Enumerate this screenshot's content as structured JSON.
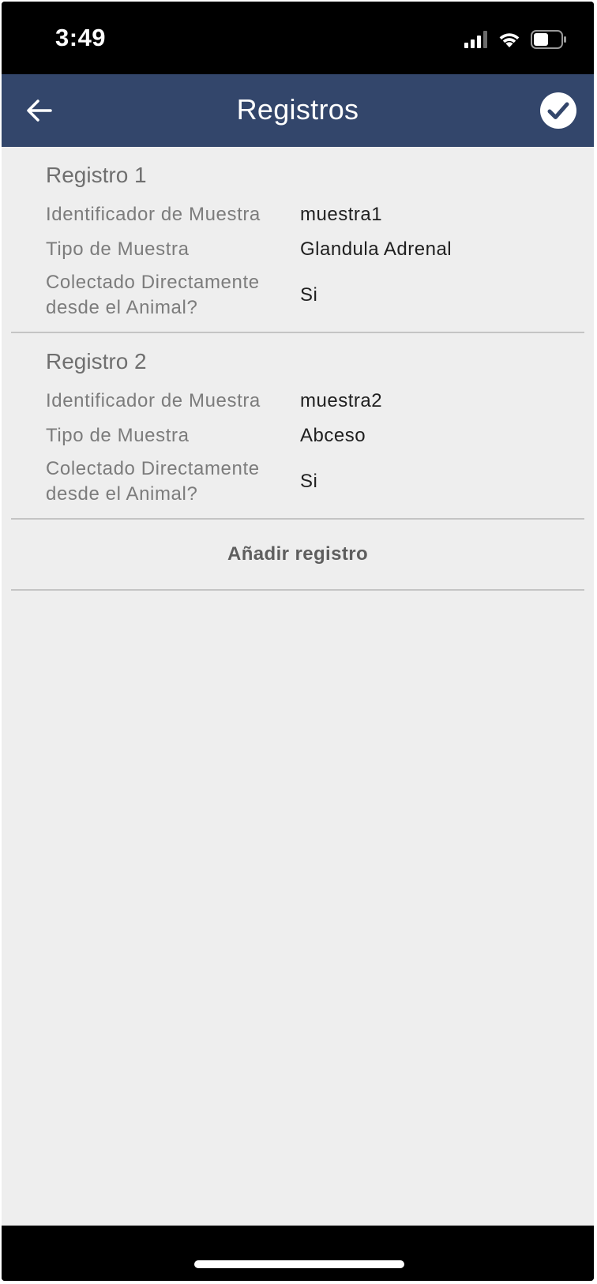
{
  "status_bar": {
    "time": "3:49",
    "icons": [
      "cellular-signal-icon",
      "wifi-icon",
      "battery-icon"
    ]
  },
  "header": {
    "title": "Registros",
    "back_icon": "arrow-left-icon",
    "confirm_icon": "check-circle-icon",
    "background_color": "#33466b"
  },
  "records": [
    {
      "title": "Registro 1",
      "fields": [
        {
          "label": "Identificador de Muestra",
          "value": "muestra1"
        },
        {
          "label": "Tipo de Muestra",
          "value": "Glandula Adrenal"
        },
        {
          "label": "Colectado Directamente desde el Animal?",
          "value": "Si"
        }
      ]
    },
    {
      "title": "Registro 2",
      "fields": [
        {
          "label": "Identificador de Muestra",
          "value": "muestra2"
        },
        {
          "label": "Tipo de Muestra",
          "value": "Abceso"
        },
        {
          "label": "Colectado Directamente desde el Animal?",
          "value": "Si"
        }
      ]
    }
  ],
  "add_record_label": "Añadir registro"
}
